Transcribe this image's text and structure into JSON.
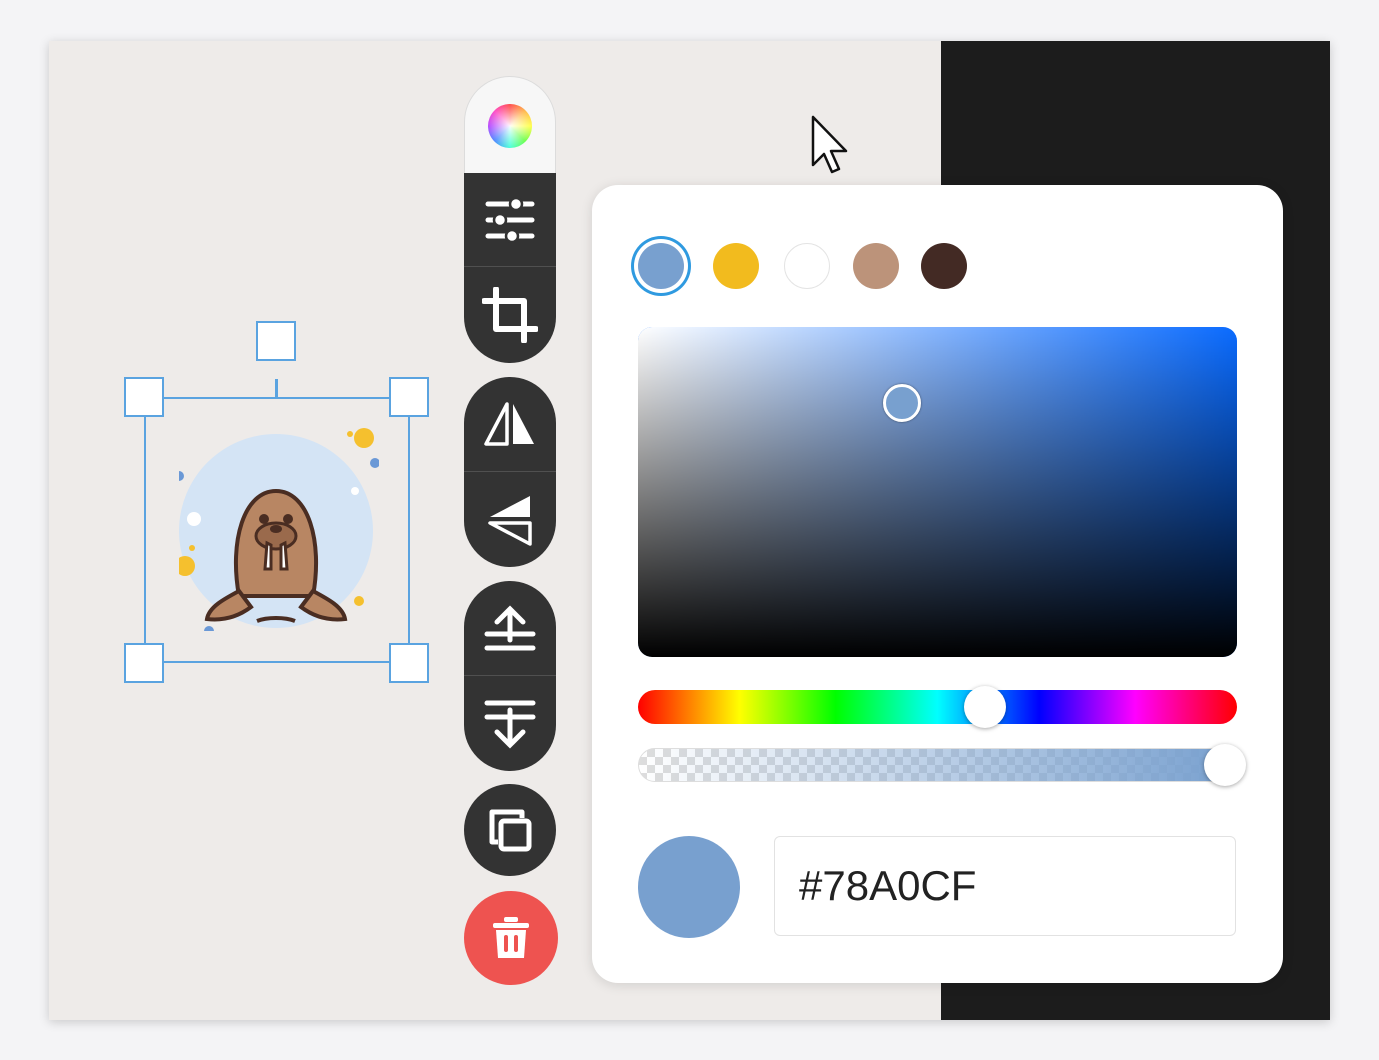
{
  "toolbar": {
    "color_button": "color-wheel-icon",
    "buttons": [
      "adjustments-icon",
      "crop-icon",
      "flip-horizontal-icon",
      "flip-vertical-icon",
      "bring-forward-icon",
      "send-backward-icon",
      "duplicate-icon",
      "trash-icon"
    ]
  },
  "color_picker": {
    "presets": [
      {
        "color": "#78A0CF",
        "selected": true
      },
      {
        "color": "#F2BB1E",
        "selected": false
      },
      {
        "color": "#FFFFFF",
        "selected": false
      },
      {
        "color": "#BC937A",
        "selected": false
      },
      {
        "color": "#432A24",
        "selected": false
      }
    ],
    "hue_color": "#0A6BFF",
    "hue_fraction": 0.58,
    "alpha_fraction": 0.98,
    "saturation_fraction": 0.44,
    "value_fraction": 0.77,
    "current_color": "#78A0CF",
    "hex_value": "#78A0CF"
  },
  "colors": {
    "selection": "#5AA3E0",
    "toolbar_bg": "#333333",
    "delete_bg": "#EE5350",
    "canvas_bg": "#EEEBE9",
    "dark_panel": "#1C1C1C"
  }
}
